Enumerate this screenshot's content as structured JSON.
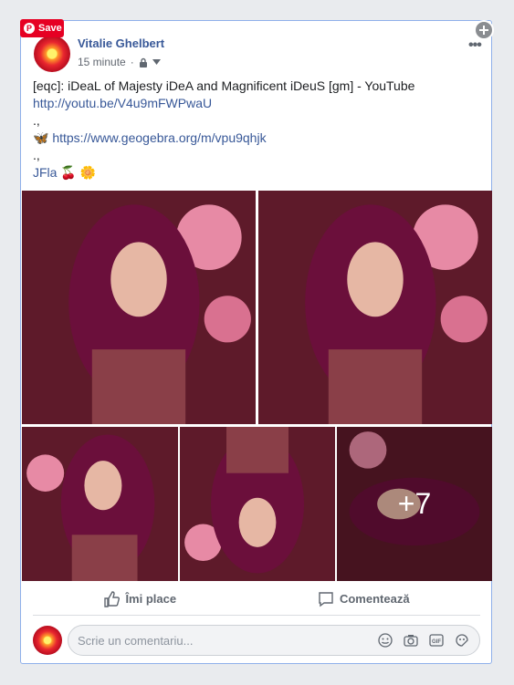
{
  "save_button": {
    "label": "Save"
  },
  "post": {
    "author": "Vitalie Ghelbert",
    "time": "15 minute",
    "lines": [
      "[eqc]: iDeaL of Majesty iDeA and Magnificent iDeuS [gm] - YouTube",
      "http://youtu.be/V4u9mFWPwaU",
      ".,",
      "https://www.geogebra.org/m/vpu9qhjk",
      ".,",
      "JFla"
    ],
    "emoji_butterfly": "🦋",
    "emoji_cherries": "🍒",
    "emoji_blossom": "🌼",
    "photo_more_count": "+7"
  },
  "actions": {
    "like_label": "Îmi place",
    "comment_label": "Comentează"
  },
  "comment_input": {
    "placeholder": "Scrie un comentariu..."
  },
  "colors": {
    "link": "#385898",
    "pin_red": "#e60023",
    "card_border": "#8fb0ea"
  }
}
